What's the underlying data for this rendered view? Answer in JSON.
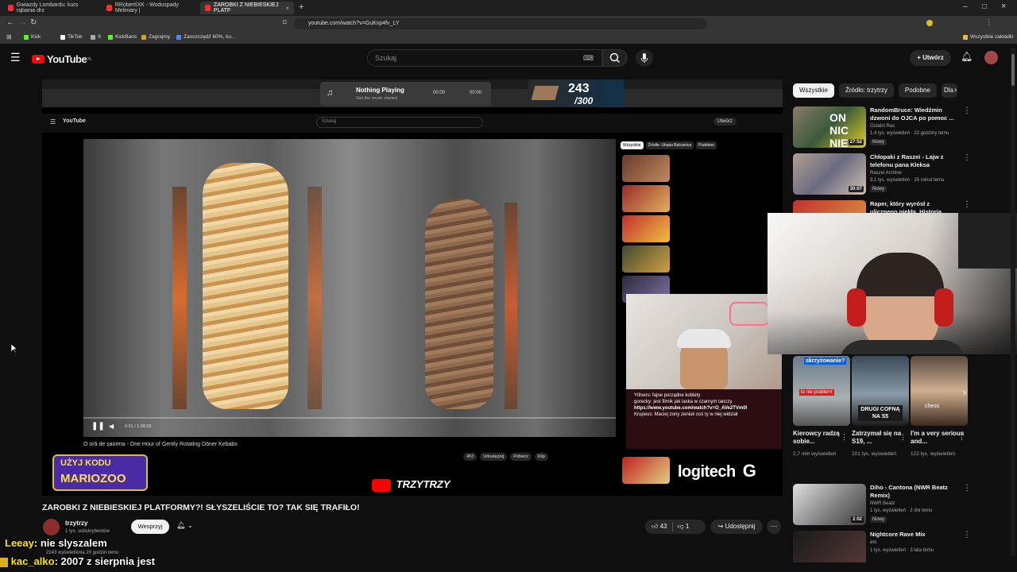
{
  "browser": {
    "tabs": [
      {
        "label": "Gwiazdy Lombardu: kurs rąbania drz",
        "active": false
      },
      {
        "label": "RRobertiXK - Wodospady Meliniary |",
        "active": false
      },
      {
        "label": "ZAROBKI Z NIEBIESKIEJ PLATF",
        "active": true
      }
    ],
    "url": "youtube.com/watch?v=GuKvp4fv_LY",
    "bookmarks": [
      "Kick",
      "TikTok",
      "X",
      "KickBans",
      "Zagrajmy",
      "Zaoszczędź 60%, ku..."
    ],
    "all_bookmarks": "Wszystkie zakładki"
  },
  "youtube": {
    "logo": "YouTube",
    "logo_country": "PL",
    "search_placeholder": "Szukaj",
    "create_label": "Utwórz"
  },
  "video": {
    "now_playing_title": "Nothing Playing",
    "now_playing_sub": "Get the music started",
    "now_playing_time_start": "00:00",
    "now_playing_time_end": "00:00",
    "counter_value": "243",
    "counter_total": "/300",
    "inner_video_title": "O oră de șaorma - One Hour of Gently Rotating Döner Kebabs",
    "inner_time": "0:01 / 1:00:56",
    "promo_line1": "UŻYJ KODU",
    "promo_line2": "MARIOZOO",
    "brand_overlay": "TRZYTRZY",
    "logitech": "logitech",
    "inner_chips": [
      "Wszystkie",
      "Źródło: Utopia Balcanica",
      "Podobne"
    ],
    "inner_actions": [
      "453",
      "Udostępnij",
      "Pobierz",
      "Klip"
    ],
    "inner_chat": [
      "Ytilvers: fajne porządne kobiety",
      "gorecky: jest filmik jak laska w czarnym tanczy",
      "https://www.youtube.com/watch?v=O_AVe2TVm0I",
      "Krupeus: Maciej zony zeniuk coś ty w niej widział"
    ]
  },
  "main": {
    "title": "ZAROBKI Z NIEBIESKIEJ PLATFORMY?! SŁYSZELIŚCIE TO? TAK SIĘ TRAFIŁO!",
    "channel": "trzytrzy",
    "subs": "1 tys. subskrybentów",
    "join_label": "Wesprzyj",
    "likes": "43",
    "dislikes": "1",
    "share_label": "Udostępnij",
    "views": "2243 wyświetlenia  20 godzin temu"
  },
  "chat_overlay": [
    {
      "user": "Leeay",
      "msg": ": nie slyszalem"
    },
    {
      "user": "kac_alko",
      "msg": ": 2007 z sierpnia jest"
    }
  ],
  "sidebar": {
    "chips": [
      "Wszystkie",
      "Źródło: trzytrzy",
      "Podobne",
      "Dla"
    ],
    "videos": [
      {
        "title": "RandomBruce: Wiedźmin dzwoni do OJCA po pomoc ...",
        "channel": "Ostatni Raz",
        "meta": "1,4 tys. wyświetleń · 22 godziny temu",
        "badge": "Nowy",
        "duration": "27:52"
      },
      {
        "title": "Chłopaki z Raszei - Lajw z telefonu pana Kleksa",
        "channel": "Raszei Archive",
        "meta": "3,1 tys. wyświetleń · 25 minut temu",
        "badge": "Nowy",
        "duration": "30:07"
      },
      {
        "title": "Raper, który wyrósł z ulicznego piekła. Historia Loui. Draco",
        "channel": "",
        "meta": "",
        "badge": "",
        "duration": ""
      },
      {
        "title": "Diho - Cantona (NWR Beatz Remix)",
        "channel": "NWR Beatz",
        "meta": "1 tys. wyświetleń · 2 dni temu",
        "badge": "Nowy",
        "duration": "2:02"
      },
      {
        "title": "Nightcore Rave Mix",
        "channel": "eto",
        "meta": "1 tys. wyświetleń · 3 lata temu",
        "badge": "",
        "duration": ""
      }
    ],
    "shorts": [
      {
        "title": "Kierowcy radzą sobie...",
        "views": "2,7 mln wyświetleń",
        "overlay": "skrzyżowanie?"
      },
      {
        "title": "Zatrzymał się na S19, ...",
        "views": "101 tys. wyświetleń",
        "overlay": "DRUGI COFNĄ NA S5"
      },
      {
        "title": "I'm a very serious and...",
        "views": "122 tys. wyświetleń",
        "overlay": "chess"
      }
    ]
  }
}
